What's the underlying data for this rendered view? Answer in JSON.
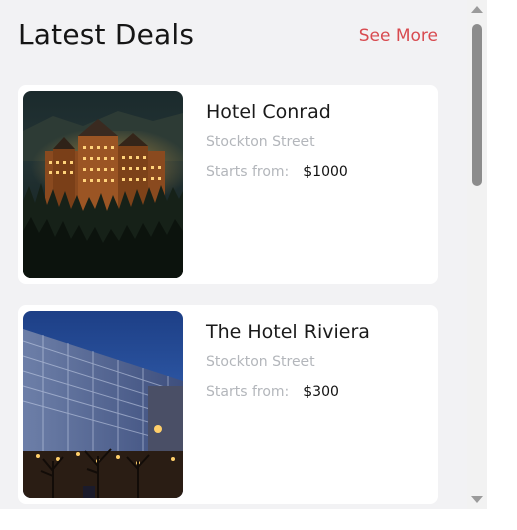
{
  "header": {
    "title": "Latest Deals",
    "see_more": "See More"
  },
  "deals": [
    {
      "name": "Hotel Conrad",
      "street": "Stockton Street",
      "price_label": "Starts from:",
      "price": "$1000",
      "image_icon": "castle-hotel-night-photo"
    },
    {
      "name": "The Hotel Riviera",
      "street": "Stockton Street",
      "price_label": "Starts from:",
      "price": "$300",
      "image_icon": "modern-hotel-dusk-photo"
    }
  ],
  "colors": {
    "accent": "#d84a4f",
    "panel_bg": "#f2f2f4",
    "muted_text": "#b3b6bb"
  }
}
